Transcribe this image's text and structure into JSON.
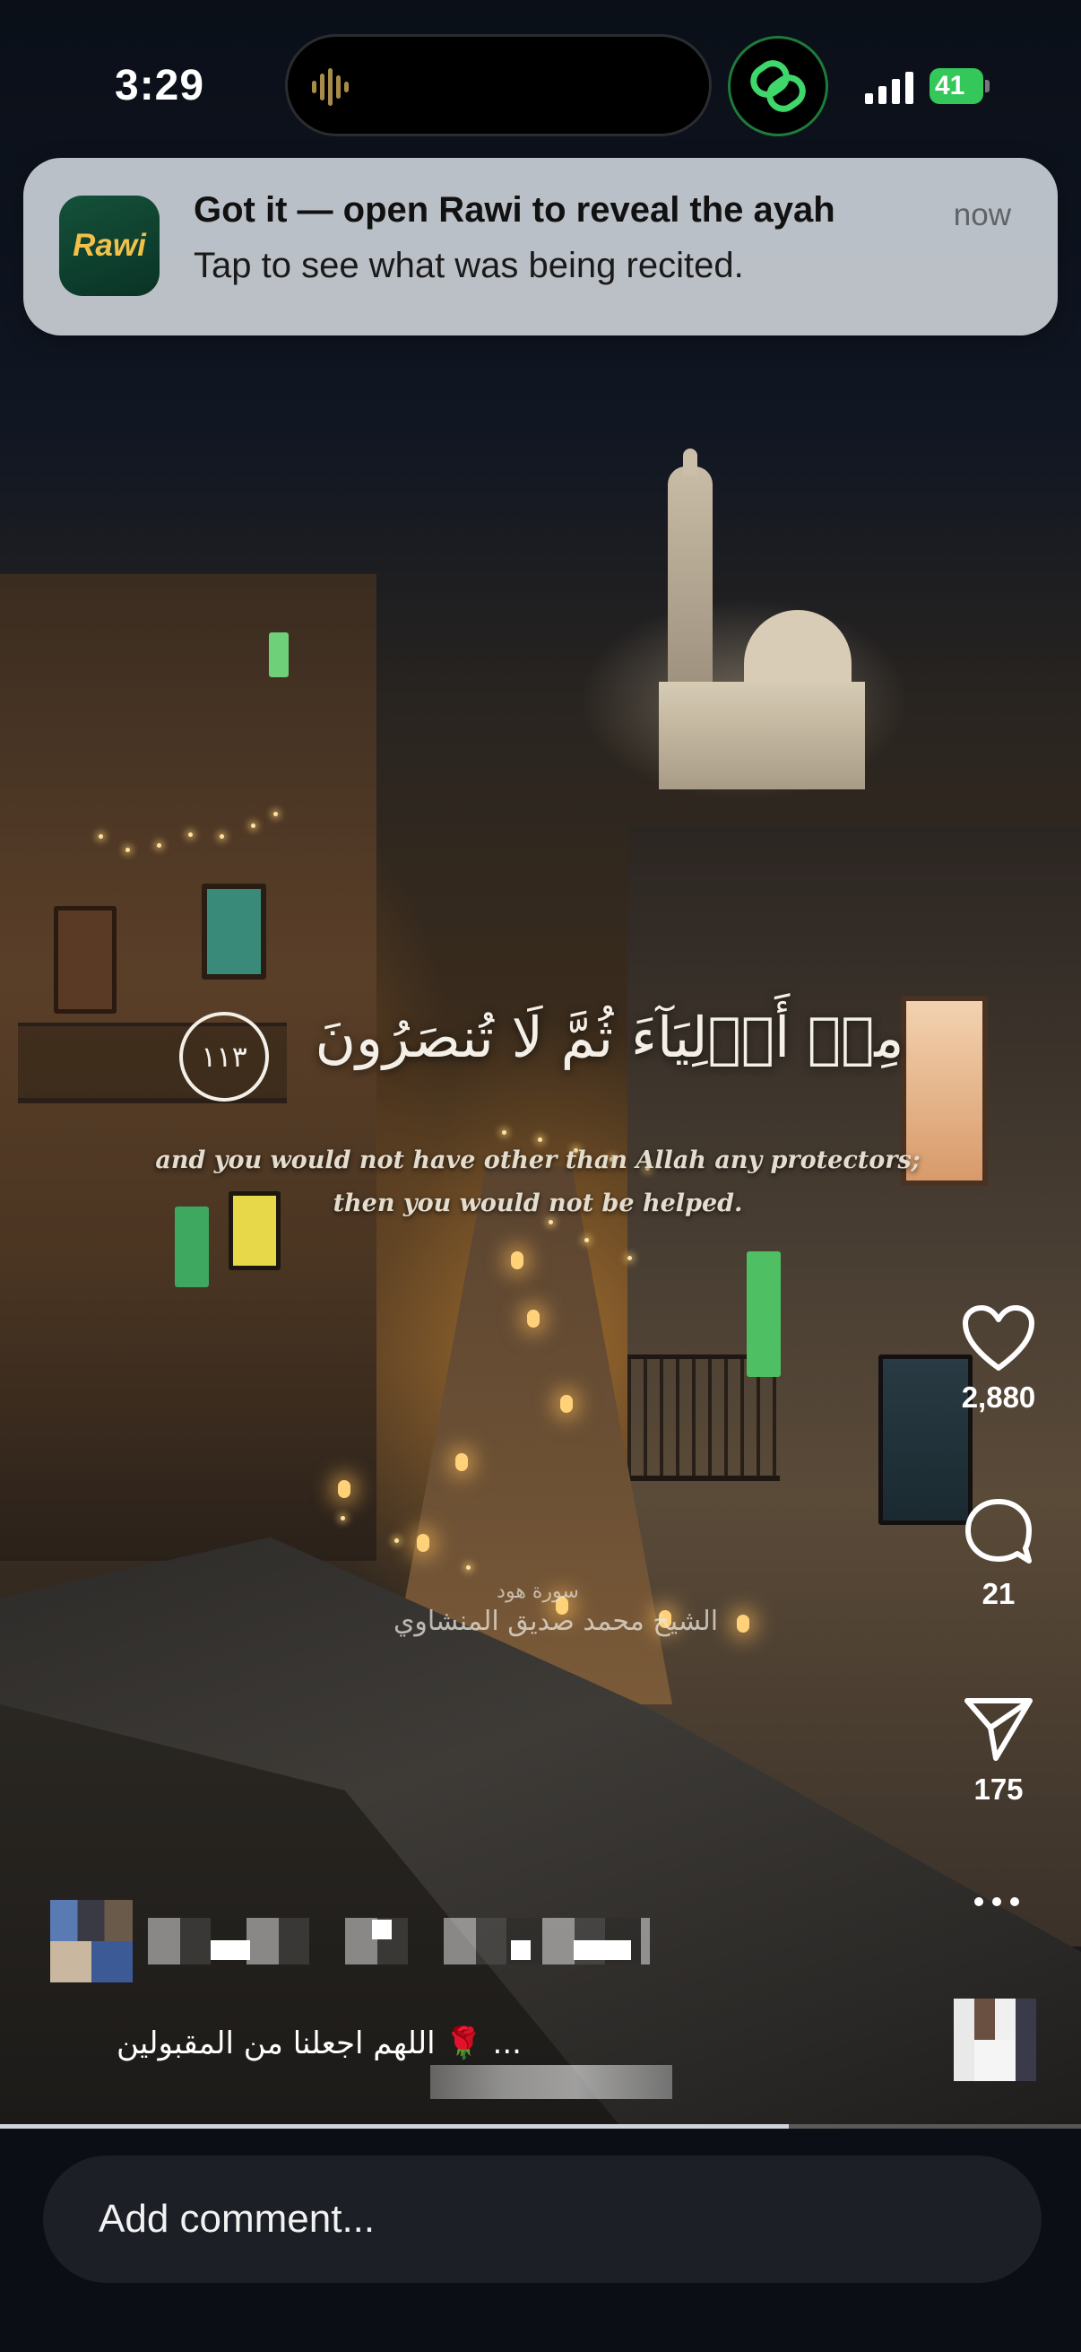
{
  "status_bar": {
    "time": "3:29",
    "battery": "41"
  },
  "notification": {
    "app_name": "Rawi",
    "title": "Got it — open Rawi to reveal the ayah",
    "body": "Tap to see what was being recited.",
    "time": "now"
  },
  "video": {
    "ayah_arabic": "مِنۡ أَوۡلِيَآءَ ثُمَّ لَا تُنصَرُونَ",
    "verse_number": "١١٣",
    "translation_line1": "and you would not have other than Allah any protectors;",
    "translation_line2": "then you would not be helped.",
    "surah_label": "سورة هود",
    "reciter": "الشيخ محمد صديق المنشاوي",
    "progress": 0.73
  },
  "actions": {
    "likes": "2,880",
    "comments": "21",
    "shares": "175"
  },
  "post": {
    "caption": "اللهم اجعلنا من المقبولين 🌹 ..."
  },
  "comment_bar": {
    "placeholder": "Add comment..."
  },
  "colors": {
    "rawi_brand": "#0a3325",
    "rawi_text": "#f2c14b",
    "battery_green": "#34c759"
  }
}
